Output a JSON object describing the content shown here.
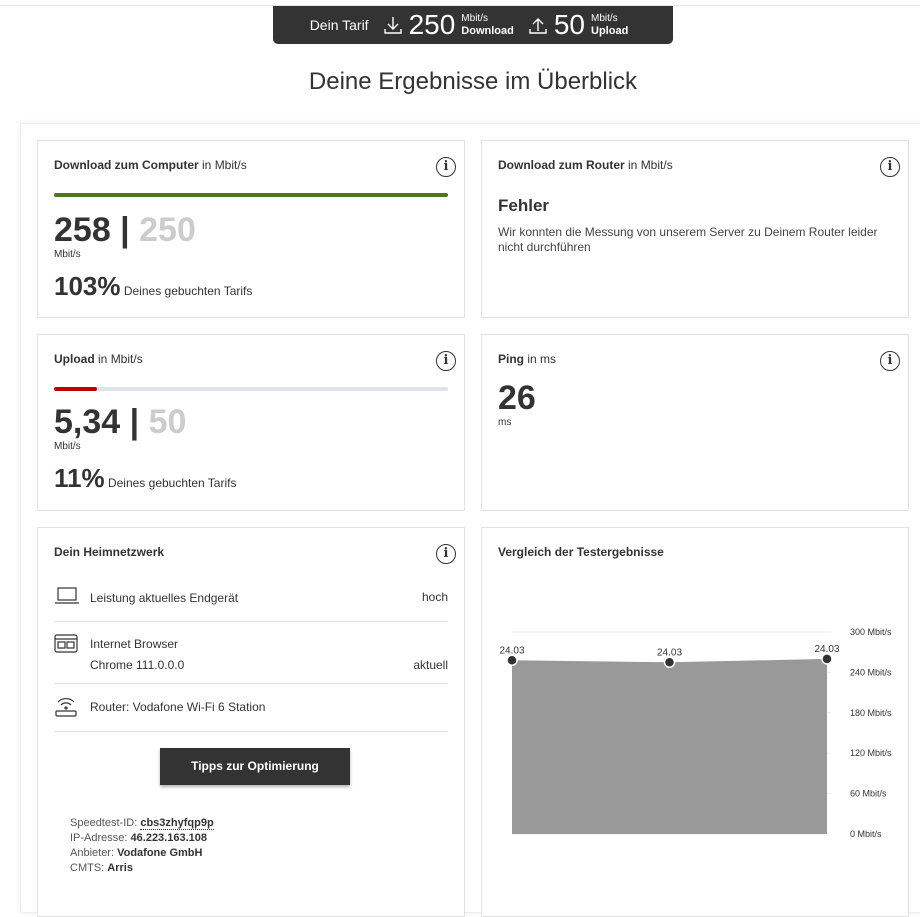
{
  "tarif": {
    "label": "Dein Tarif",
    "download": "250",
    "download_unit": "Mbit/s",
    "download_label": "Download",
    "upload": "50",
    "upload_unit": "Mbit/s",
    "upload_label": "Upload"
  },
  "page_title": "Deine Ergebnisse im Überblick",
  "download_computer": {
    "title": "Download zum Computer",
    "unit_suffix": "in Mbit/s",
    "value": "258",
    "tarif": "250",
    "unit": "Mbit/s",
    "percent": "103%",
    "percent_text": "Deines gebuchten Tarifs",
    "progress": 1.0,
    "color": "#4a7a1a"
  },
  "download_router": {
    "title": "Download zum Router",
    "unit_suffix": "in Mbit/s",
    "error_title": "Fehler",
    "error_text": "Wir konnten die Messung von unserem Server zu Deinem Router leider nicht durchführen"
  },
  "upload": {
    "title": "Upload",
    "unit_suffix": "in Mbit/s",
    "value": "5,34",
    "tarif": "50",
    "unit": "Mbit/s",
    "percent": "11%",
    "percent_text": "Deines gebuchten Tarifs",
    "progress": 0.11,
    "color": "#c00000"
  },
  "ping": {
    "title": "Ping",
    "unit_suffix": "in ms",
    "value": "26",
    "unit": "ms"
  },
  "heimnetz": {
    "title": "Dein Heimnetzwerk",
    "rows": [
      {
        "icon": "laptop-icon",
        "label": "Leistung aktuelles Endgerät",
        "line2": "",
        "status": "hoch"
      },
      {
        "icon": "browser-icon",
        "label": "Internet Browser",
        "line2": "Chrome 111.0.0.0",
        "status": "aktuell"
      },
      {
        "icon": "router-icon",
        "label": "Router: Vodafone Wi-Fi 6 Station",
        "line2": "",
        "status": ""
      }
    ],
    "button": "Tipps zur Optimierung",
    "meta": {
      "id_label": "Speedtest-ID:",
      "id": "cbs3zhyfqp9p",
      "ip_label": "IP-Adresse:",
      "ip": "46.223.163.108",
      "provider_label": "Anbieter:",
      "provider": "Vodafone GmbH",
      "cmts_label": "CMTS:",
      "cmts": "Arris"
    }
  },
  "chart_data": {
    "type": "area",
    "title": "Vergleich der Testergebnisse",
    "categories": [
      "24.03",
      "24.03",
      "24.03"
    ],
    "values": [
      258,
      255,
      260
    ],
    "ylim": [
      0,
      300
    ],
    "yticks": [
      "0 Mbit/s",
      "60 Mbit/s",
      "120 Mbit/s",
      "180 Mbit/s",
      "240 Mbit/s",
      "300 Mbit/s"
    ],
    "axis_position": "right",
    "fill_color": "#999999"
  }
}
